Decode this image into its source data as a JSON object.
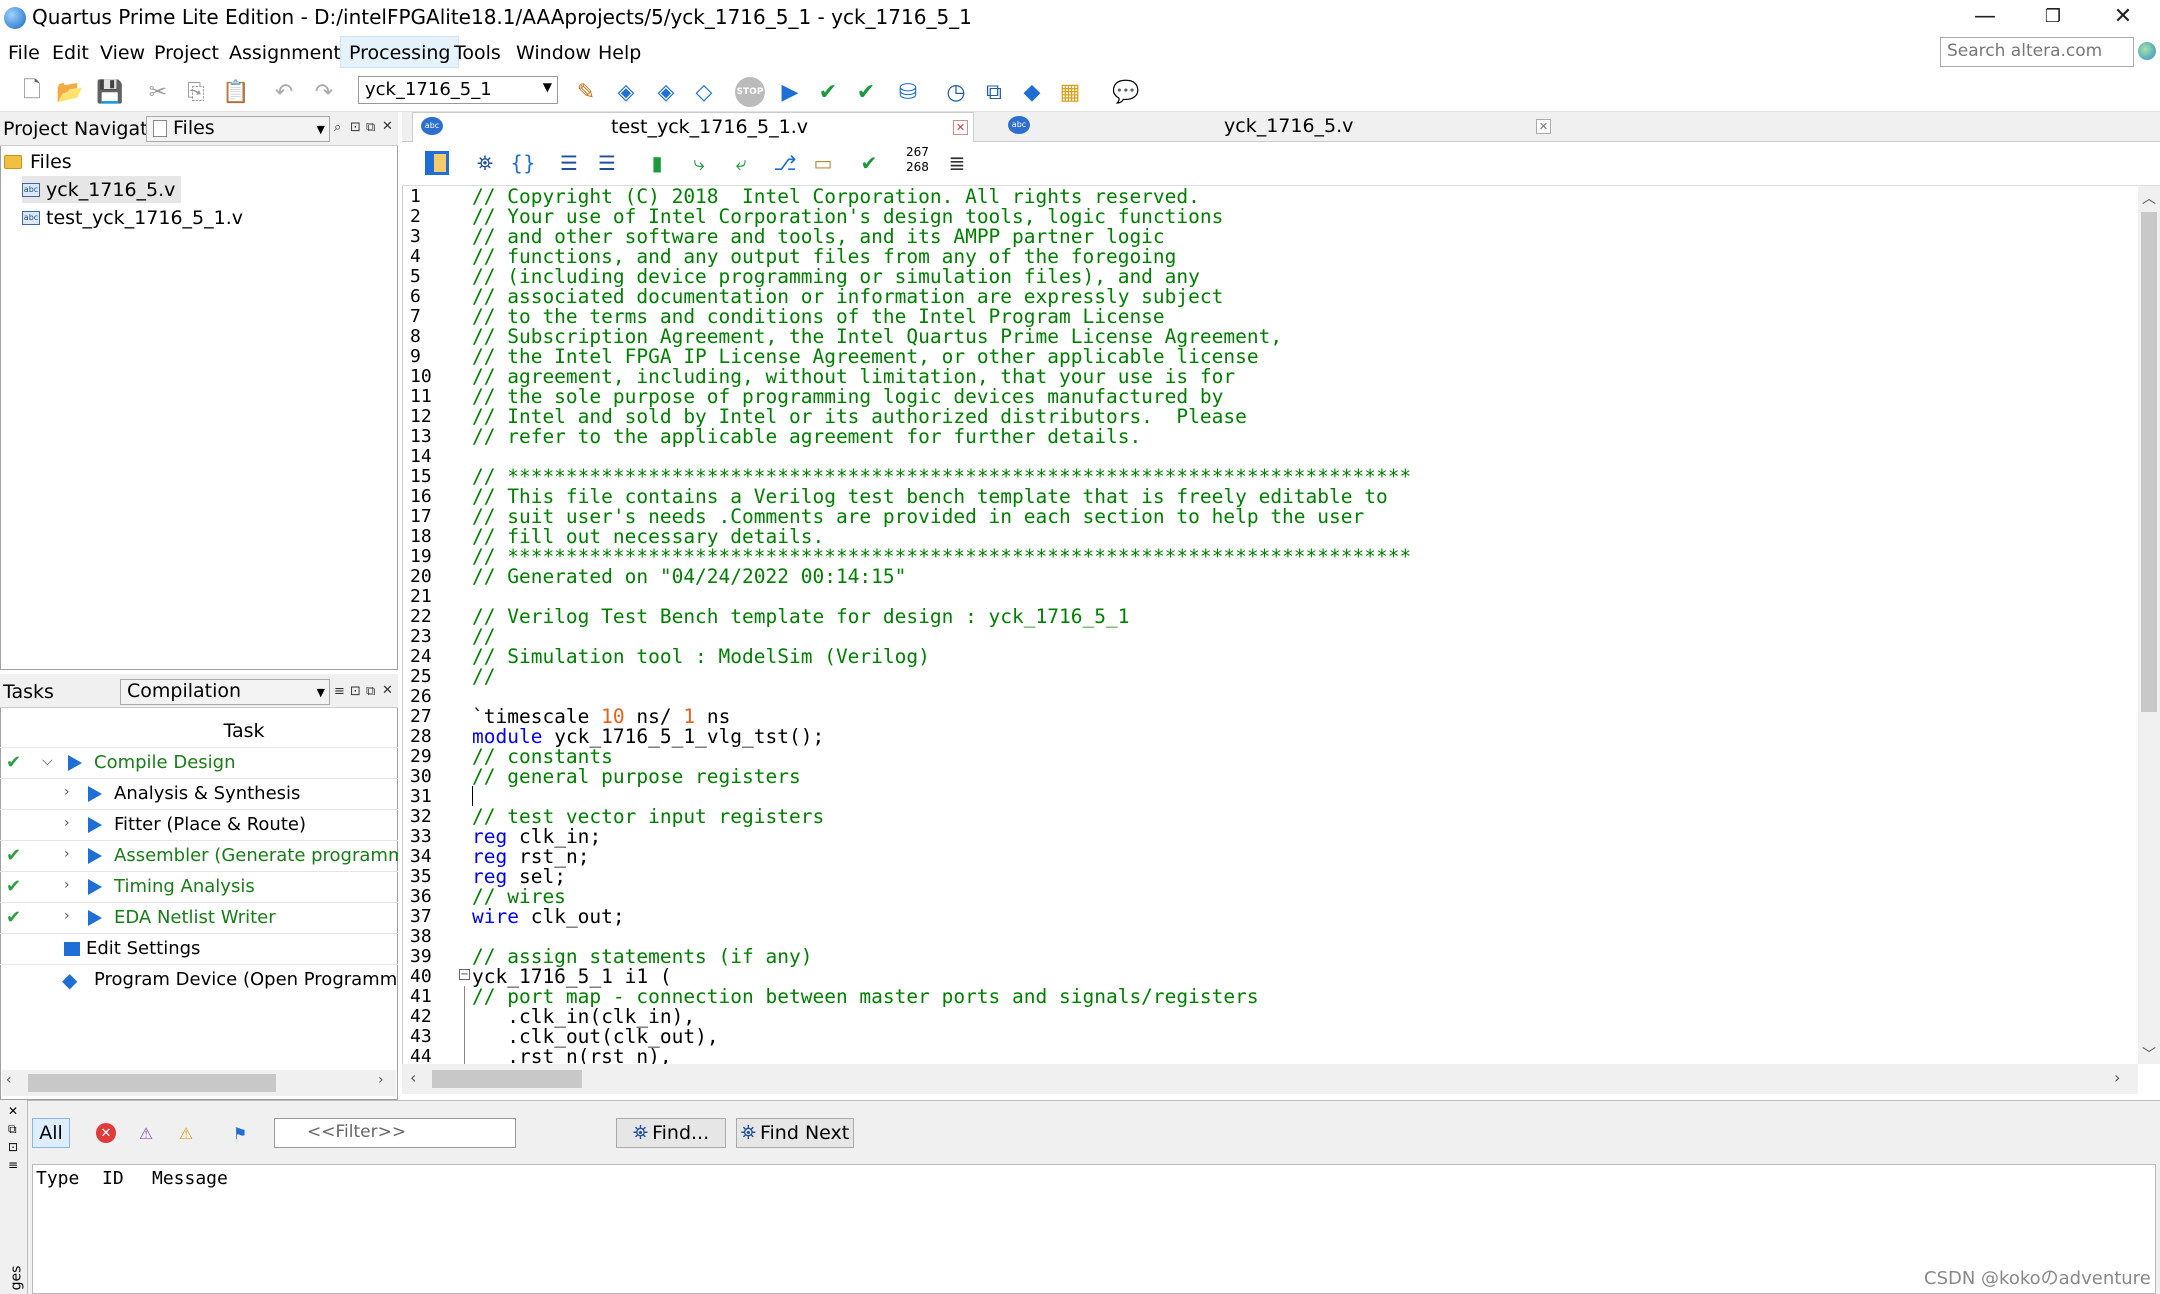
{
  "window": {
    "title": "Quartus Prime Lite Edition - D:/intelFPGAlite18.1/AAAprojects/5/yck_1716_5_1 - yck_1716_5_1",
    "minimize": "—",
    "restore": "❐",
    "close": "✕"
  },
  "menu": {
    "items": [
      "File",
      "Edit",
      "View",
      "Project",
      "Assignments",
      "Processing",
      "Tools",
      "Window",
      "Help"
    ],
    "active": "Processing",
    "search_placeholder": "Search altera.com"
  },
  "toolbar": {
    "revision": "yck_1716_5_1",
    "stop_label": "STOP"
  },
  "project_navigator": {
    "title": "Project Navigator",
    "view": "Files",
    "root": "Files",
    "files": [
      "yck_1716_5.v",
      "test_yck_1716_5_1.v"
    ],
    "selected": "yck_1716_5.v"
  },
  "tasks": {
    "title": "Tasks",
    "flow": "Compilation",
    "column": "Task",
    "rows": [
      {
        "label": "Compile Design",
        "done": true,
        "level": 0
      },
      {
        "label": "Analysis & Synthesis",
        "done": false,
        "level": 1
      },
      {
        "label": "Fitter (Place & Route)",
        "done": false,
        "level": 1
      },
      {
        "label": "Assembler (Generate programming",
        "done": true,
        "level": 1
      },
      {
        "label": "Timing Analysis",
        "done": true,
        "level": 1
      },
      {
        "label": "EDA Netlist Writer",
        "done": true,
        "level": 1
      },
      {
        "label": "Edit Settings",
        "done": false,
        "level": 0
      },
      {
        "label": "Program Device (Open Programmer)",
        "done": false,
        "level": 0
      }
    ]
  },
  "editor": {
    "tabs": [
      {
        "label": "test_yck_1716_5_1.v",
        "active": true
      },
      {
        "label": "yck_1716_5.v",
        "active": false
      }
    ],
    "line_counter_top": "267",
    "line_counter_bottom": "268",
    "lines": [
      "// Copyright (C) 2018  Intel Corporation. All rights reserved.",
      "// Your use of Intel Corporation's design tools, logic functions",
      "// and other software and tools, and its AMPP partner logic",
      "// functions, and any output files from any of the foregoing",
      "// (including device programming or simulation files), and any",
      "// associated documentation or information are expressly subject",
      "// to the terms and conditions of the Intel Program License",
      "// Subscription Agreement, the Intel Quartus Prime License Agreement,",
      "// the Intel FPGA IP License Agreement, or other applicable license",
      "// agreement, including, without limitation, that your use is for",
      "// the sole purpose of programming logic devices manufactured by",
      "// Intel and sold by Intel or its authorized distributors.  Please",
      "// refer to the applicable agreement for further details.",
      "",
      "// *****************************************************************************",
      "// This file contains a Verilog test bench template that is freely editable to",
      "// suit user's needs .Comments are provided in each section to help the user",
      "// fill out necessary details.",
      "// *****************************************************************************",
      "// Generated on \"04/24/2022 00:14:15\"",
      "",
      "// Verilog Test Bench template for design : yck_1716_5_1",
      "//",
      "// Simulation tool : ModelSim (Verilog)",
      "//",
      "",
      "`timescale 10 ns/ 1 ns",
      "module yck_1716_5_1_vlg_tst();",
      "// constants",
      "// general purpose registers",
      "",
      "// test vector input registers",
      "reg clk_in;",
      "reg rst_n;",
      "reg sel;",
      "// wires",
      "wire clk_out;",
      "",
      "// assign statements (if any)",
      "yck_1716_5_1 i1 (",
      "// port map - connection between master ports and signals/registers",
      "   .clk_in(clk_in),",
      "   .clk_out(clk_out),",
      "   .rst_n(rst_n),"
    ]
  },
  "messages": {
    "all_label": "All",
    "filter_placeholder": "<<Filter>>",
    "find_label": "Find...",
    "find_next_label": "Find Next",
    "columns": [
      "Type",
      "ID",
      "Message"
    ],
    "side_label": "ges"
  },
  "watermark": "CSDN @kokoのadventure",
  "colors": {
    "comment": "#008000",
    "keyword": "#0000ff",
    "number": "#e8601c",
    "task_done": "#177d17"
  }
}
